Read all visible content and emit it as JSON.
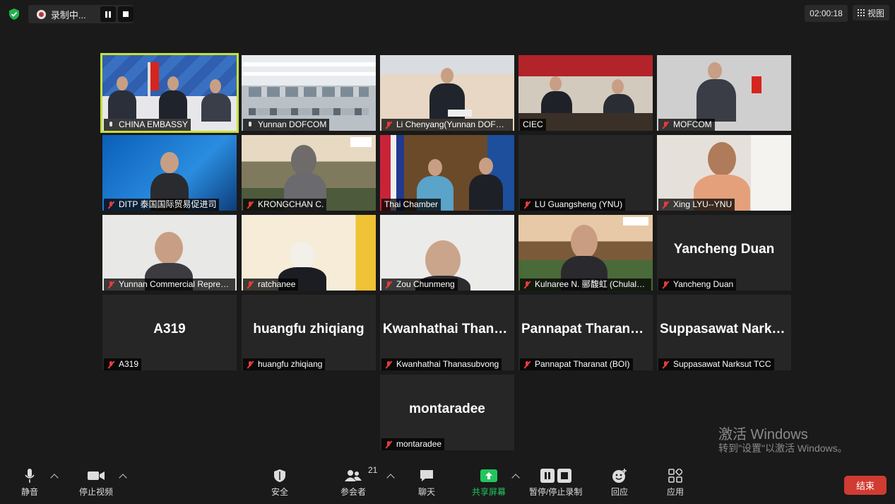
{
  "top": {
    "recording_label": "录制中...",
    "timer": "02:00:18",
    "view_label": "视图"
  },
  "tiles": [
    {
      "name": "CHINA EMBASSY"
    },
    {
      "name": "Yunnan DOFCOM"
    },
    {
      "name": "Li Chenyang(Yunnan DOFCOM)"
    },
    {
      "name": "CIEC"
    },
    {
      "name": "MOFCOM"
    },
    {
      "name": "DITP 泰国国际贸易促进司"
    },
    {
      "name": "KRONGCHAN C."
    },
    {
      "name": "Thai Chamber"
    },
    {
      "name": "LU Guangsheng (YNU)"
    },
    {
      "name": "Xing LYU--YNU"
    },
    {
      "name": "Yunnan Commercial Representative"
    },
    {
      "name": "ratchanee"
    },
    {
      "name": "Zou Chunmeng"
    },
    {
      "name": "Kulnaree N. 郦馥虹 (Chulalongkorn)"
    },
    {
      "name": "Yancheng Duan",
      "big": "Yancheng Duan"
    },
    {
      "name": "A319",
      "big": "A319"
    },
    {
      "name": "huangfu zhiqiang",
      "big": "huangfu zhiqiang"
    },
    {
      "name": "Kwanhathai Thanasubvong",
      "big": "Kwanhathai  Thanasubvong"
    },
    {
      "name": "Pannapat Tharanat (BOI)",
      "big": "Pannapat  Tharanat (BOI)"
    },
    {
      "name": "Suppasawat Narksut TCC",
      "big": "Suppasawat  Narksut TCC"
    },
    {
      "name": "montaradee",
      "big": "montaradee"
    }
  ],
  "watermark": {
    "line1": "激活 Windows",
    "line2": "转到\"设置\"以激活 Windows。"
  },
  "toolbar": {
    "mute": "静音",
    "stop_video": "停止视频",
    "security": "安全",
    "participants": "参会者",
    "participants_count": "21",
    "chat": "聊天",
    "share": "共享屏幕",
    "record": "暂停/停止录制",
    "reactions": "回应",
    "apps": "应用",
    "end": "结束"
  },
  "colors": {
    "background": "#1a1a1a",
    "active_speaker_border": "#c5e03a",
    "muted_mic": "#e83b3b",
    "share_green": "#22c55e",
    "end_button": "#d03b32"
  }
}
